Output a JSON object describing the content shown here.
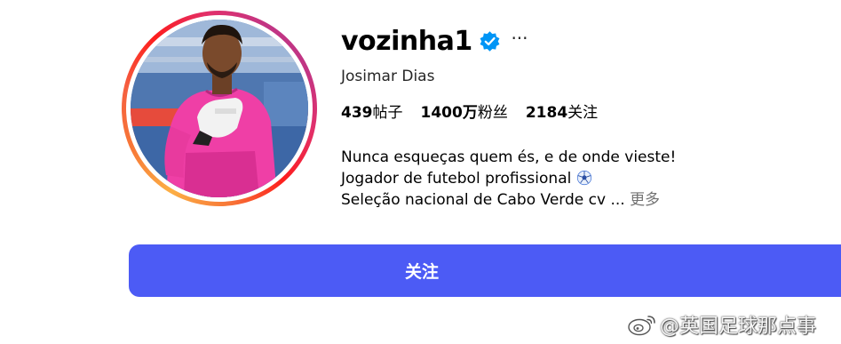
{
  "profile": {
    "username": "vozinha1",
    "full_name": "Josimar Dias",
    "verified": true,
    "more_glyph": "···"
  },
  "stats": {
    "posts_count": "439",
    "posts_label": "帖子",
    "followers_count": "1400万",
    "followers_label": "粉丝",
    "following_count": "2184",
    "following_label": "关注"
  },
  "bio": {
    "line1": "Nunca esqueças quem és, e de onde vieste!",
    "line2": "Jogador de futebol profissional",
    "line2_icon": "soccer-ball-icon",
    "line3": "Seleção nacional de Cabo Verde cv ...",
    "more_label": "更多"
  },
  "actions": {
    "follow_label": "关注"
  },
  "watermark": {
    "text": "@英国足球那点事"
  },
  "colors": {
    "follow_button": "#4c5bf5",
    "verified_badge": "#0095f6",
    "secondary_text": "#737373",
    "story_ring_start": "#fcaf45",
    "story_ring_end": "#c13584"
  }
}
